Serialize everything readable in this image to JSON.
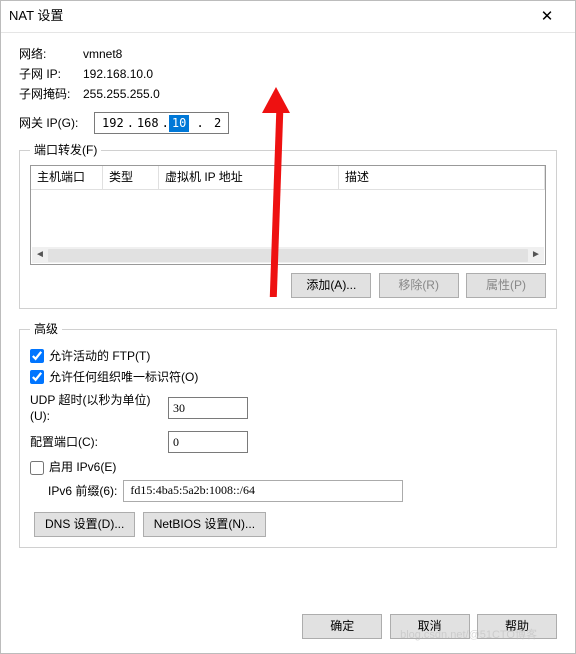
{
  "title": "NAT 设置",
  "info": {
    "net_label": "网络:",
    "net_value": "vmnet8",
    "subnet_label": "子网 IP:",
    "subnet_value": "192.168.10.0",
    "mask_label": "子网掩码:",
    "mask_value": "255.255.255.0",
    "gw_label": "网关 IP(G):",
    "ip": {
      "a": "192",
      "b": "168",
      "c": "10",
      "d": "2"
    }
  },
  "pf": {
    "legend": "端口转发(F)",
    "cols": {
      "c1": "主机端口",
      "c2": "类型",
      "c3": "虚拟机 IP 地址",
      "c4": "描述"
    },
    "btn_add": "添加(A)...",
    "btn_remove": "移除(R)",
    "btn_props": "属性(P)"
  },
  "adv": {
    "legend": "高级",
    "ftp": "允许活动的 FTP(T)",
    "org": "允许任何组织唯一标识符(O)",
    "udp_label": "UDP 超时(以秒为单位)(U):",
    "udp_val": "30",
    "cfg_label": "配置端口(C):",
    "cfg_val": "0",
    "ipv6": "启用 IPv6(E)",
    "prefix_label": "IPv6 前缀(6):",
    "prefix_val": "fd15:4ba5:5a2b:1008::/64",
    "dns": "DNS 设置(D)...",
    "netbios": "NetBIOS 设置(N)..."
  },
  "footer": {
    "ok": "确定",
    "cancel": "取消",
    "help": "帮助"
  },
  "watermark": "blog.csdn.net/@51CTO博客"
}
